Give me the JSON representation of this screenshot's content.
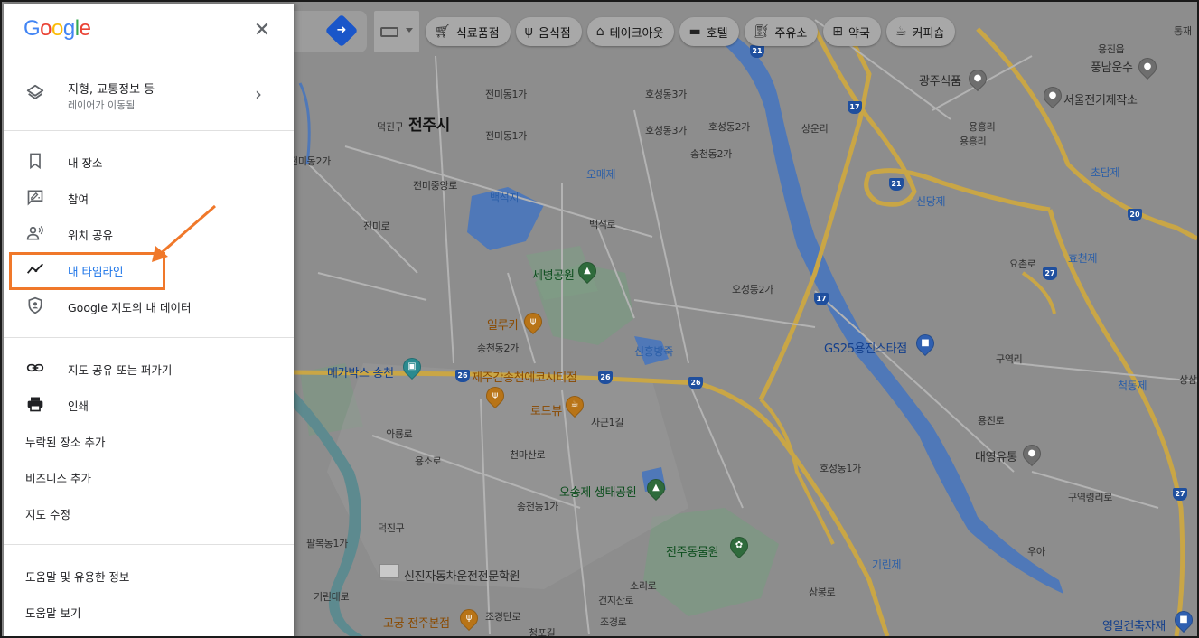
{
  "sidebar": {
    "logo": "Google",
    "layers": {
      "title": "지형, 교통정보 등",
      "subtitle": "레이어가 이동됨"
    },
    "section1": [
      {
        "label": "내 장소",
        "icon": "bookmark-icon"
      },
      {
        "label": "참여",
        "icon": "rate-review-icon"
      },
      {
        "label": "위치 공유",
        "icon": "location-share-icon"
      },
      {
        "label": "내 타임라인",
        "icon": "timeline-icon",
        "active": true
      },
      {
        "label": "Google 지도의 내 데이터",
        "icon": "shield-person-icon"
      }
    ],
    "section2": [
      {
        "label": "지도 공유 또는 퍼가기",
        "icon": "link-icon"
      },
      {
        "label": "인쇄",
        "icon": "print-icon"
      },
      {
        "label": "누락된 장소 추가"
      },
      {
        "label": "비즈니스 추가"
      },
      {
        "label": "지도 수정"
      }
    ],
    "section3": [
      {
        "label": "도움말 및 유용한 정보"
      },
      {
        "label": "도움말 보기"
      }
    ]
  },
  "chips": [
    {
      "label": "식료품점",
      "icon": "cart-icon"
    },
    {
      "label": "음식점",
      "icon": "restaurant-icon"
    },
    {
      "label": "테이크아웃",
      "icon": "takeout-icon"
    },
    {
      "label": "호텔",
      "icon": "hotel-icon"
    },
    {
      "label": "주유소",
      "icon": "gas-station-icon"
    },
    {
      "label": "약국",
      "icon": "pharmacy-icon"
    },
    {
      "label": "커피숍",
      "icon": "coffee-icon"
    }
  ],
  "map": {
    "city": "전주시",
    "labels": {
      "l1": "전미동1가",
      "l2": "덕진구",
      "l3": "전미동2가",
      "l4": "전미동1가",
      "l5": "전미중앙로",
      "l6": "전미로",
      "l7": "백석지",
      "l8": "오매제",
      "l9": "백석로",
      "l10": "호성동3가",
      "l11": "호성동2가",
      "l12": "호성동3가",
      "l13": "송천동2가",
      "l14": "용진읍",
      "l15": "상운리",
      "l16": "광주식품",
      "l17": "풍남운수",
      "l18": "서울전기제작소",
      "l19": "용흥리",
      "l20": "용흥리",
      "l21": "초담제",
      "l22": "신당제",
      "l23": "효천제",
      "l24": "요촌로",
      "l25": "구역리",
      "l26": "척동제",
      "l27": "세병공원",
      "l28": "일루카",
      "l29": "신흥방죽",
      "l30": "오성동2가",
      "l31": "GS25용진스타점",
      "l32": "메가박스 송천",
      "l33": "제주간송천에코시티점",
      "l34": "로드뷰",
      "l35": "사근1길",
      "l36": "송천동2가",
      "l37": "천마산로",
      "l38": "용소로",
      "l39": "오송제 생태공원",
      "l40": "송천동1가",
      "l41": "덕진구",
      "l42": "팔복동1가",
      "l43": "전주동물원",
      "l44": "기린제",
      "l45": "대영유통",
      "l46": "호성동1가",
      "l47": "신진자동차운전전문학원",
      "l48": "고궁 전주본점",
      "l49": "영일건축자재",
      "l50": "구역령리로",
      "l51": "상삼",
      "l52": "용진로",
      "l53": "통재",
      "l54": "와룡로",
      "l55": "소리로",
      "l56": "조경단로",
      "l57": "청포길",
      "l58": "기린대로",
      "l59": "우아",
      "l60": "삼봉로",
      "l61": "건지산로",
      "l62": "조경로"
    },
    "shields": [
      "21",
      "17",
      "21",
      "20",
      "27",
      "17",
      "26",
      "26",
      "26",
      "27"
    ]
  }
}
